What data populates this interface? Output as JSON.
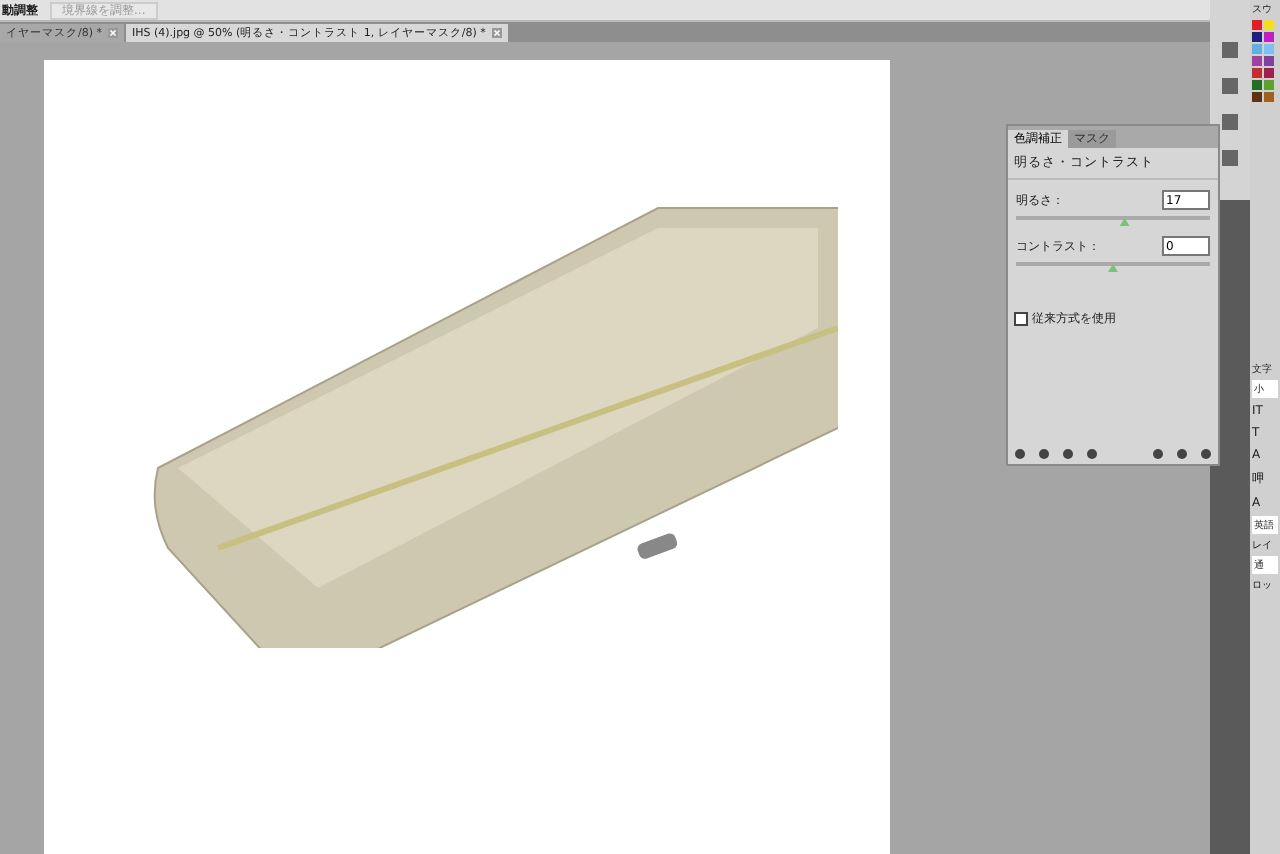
{
  "options_bar": {
    "label": "動調整",
    "refine_button": {
      "label": "境界線を調整...",
      "disabled": true
    }
  },
  "document_tabs": [
    {
      "title": "イヤーマスク/8) *",
      "selected": false
    },
    {
      "title": "IHS (4).jpg @ 50% (明るさ・コントラスト 1, レイヤーマスク/8) *",
      "selected": true
    }
  ],
  "adjustments_panel": {
    "tabs": [
      {
        "label": "色調補正",
        "selected": true
      },
      {
        "label": "マスク",
        "selected": false
      }
    ],
    "title": "明るさ・コントラスト",
    "controls": [
      {
        "label": "明るさ：",
        "value": "17",
        "level": 0.56
      },
      {
        "label": "コントラスト：",
        "value": "0",
        "level": 0.5
      }
    ],
    "legacy": {
      "label": "従来方式を使用",
      "checked": false
    }
  },
  "right_panels": {
    "swatches_tab": "スウ",
    "character_tab": "文字",
    "font_field": "小",
    "text_tools": [
      "IT",
      "T",
      "A",
      "呷",
      "A"
    ],
    "lang_field": "英語",
    "layers_tab": "レイ",
    "blend_field": "通",
    "lock_label": "ロッ"
  }
}
